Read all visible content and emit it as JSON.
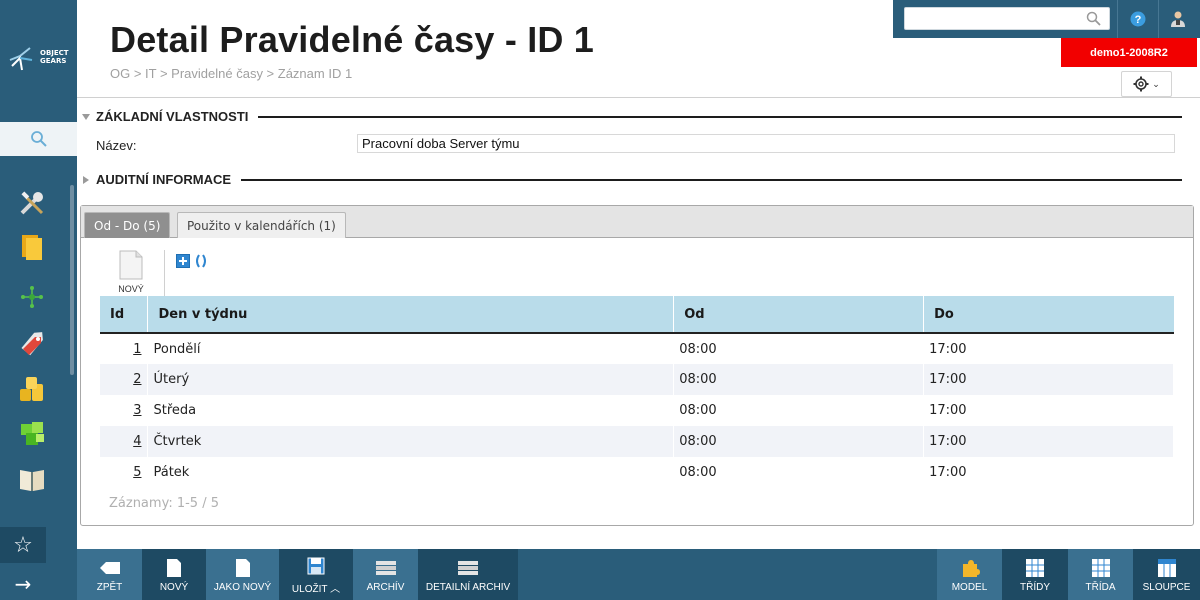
{
  "header": {
    "title": "Detail Pravidelné časy - ID 1",
    "breadcrumb": "OG > IT > Pravidelné časy > Záznam ID 1",
    "server": "demo1-2008R2",
    "search_value": "",
    "gear_caret": "⌄"
  },
  "logo": {
    "line1": "OBJECT",
    "line2": "GEARS"
  },
  "sidebar": {
    "icons": [
      "tools-icon",
      "folder-icon",
      "network-icon",
      "tag-icon",
      "coins-icon",
      "cubes-icon",
      "book-icon"
    ]
  },
  "sections": {
    "basic": "ZÁKLADNÍ VLASTNOSTI",
    "audit": "AUDITNÍ INFORMACE"
  },
  "form": {
    "name_label": "Název:",
    "name_value": "Pracovní doba Server týmu"
  },
  "tabs": [
    {
      "label": "Od - Do (5)",
      "active": true
    },
    {
      "label": "Použito v kalendářích (1)",
      "active": false
    }
  ],
  "toolbar": {
    "new_label": "NOVÝ"
  },
  "table": {
    "columns": [
      "Id",
      "Den v týdnu",
      "Od",
      "Do"
    ],
    "rows": [
      {
        "id": "1",
        "day": "Pondělí",
        "from": "08:00",
        "to": "17:00"
      },
      {
        "id": "2",
        "day": "Úterý",
        "from": "08:00",
        "to": "17:00"
      },
      {
        "id": "3",
        "day": "Středa",
        "from": "08:00",
        "to": "17:00"
      },
      {
        "id": "4",
        "day": "Čtvrtek",
        "from": "08:00",
        "to": "17:00"
      },
      {
        "id": "5",
        "day": "Pátek",
        "from": "08:00",
        "to": "17:00"
      }
    ],
    "records": "Záznamy: 1-5 / 5"
  },
  "bottombar": {
    "back": "ZPĚT",
    "new": "NOVÝ",
    "as_new": "JAKO NOVÝ",
    "save": "ULOŽIT",
    "archive": "ARCHÍV",
    "detail_archive": "DETAILNÍ ARCHIV",
    "model": "MODEL",
    "classes": "TŘÍDY",
    "class": "TŘÍDA",
    "columns": "SLOUPCE"
  },
  "colors": {
    "sidebar": "#2a5d7a",
    "accent_red": "#f20000",
    "table_header": "#b9dcea"
  }
}
